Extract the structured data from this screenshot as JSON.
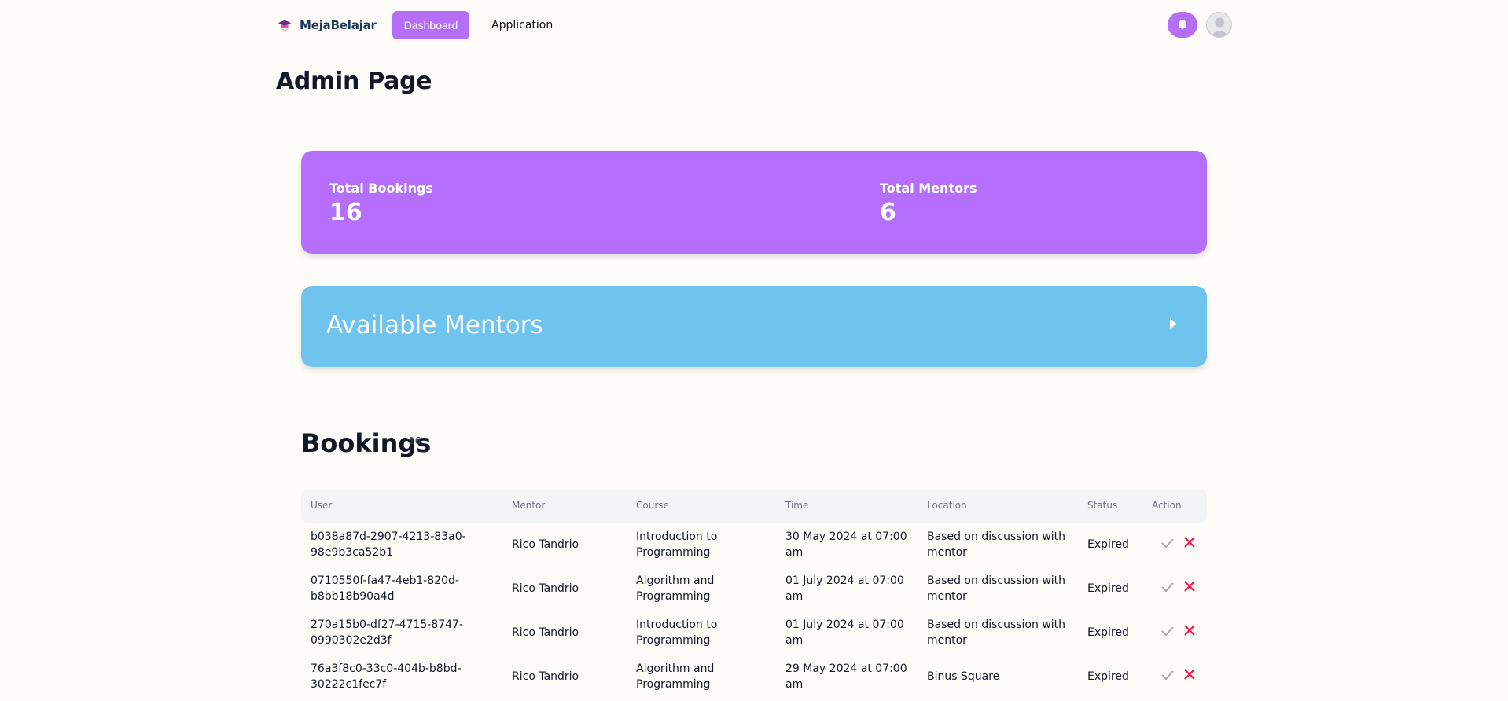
{
  "header": {
    "brand": "MejaBelajar",
    "nav": [
      {
        "label": "Dashboard",
        "active": true
      },
      {
        "label": "Application",
        "active": false
      }
    ],
    "accent_color": "#b46ef8"
  },
  "page": {
    "title": "Admin Page"
  },
  "stats": {
    "total_bookings_label": "Total Bookings",
    "total_bookings_value": "16",
    "total_mentors_label": "Total Mentors",
    "total_mentors_value": "6"
  },
  "mentors_panel": {
    "title": "Available Mentors"
  },
  "bookings": {
    "title": "Bookings",
    "count": "16",
    "columns": [
      "User",
      "Mentor",
      "Course",
      "Time",
      "Location",
      "Status",
      "Action"
    ],
    "rows": [
      {
        "user_line1": "b038a87d-2907-4213-83a0-",
        "user_line2": "98e9b3ca52b1",
        "mentor": "Rico Tandrio",
        "course_line1": "Introduction to",
        "course_line2": "Programming",
        "time_line1": "30 May 2024 at 07:00",
        "time_line2": "am",
        "location_line1": "Based on discussion with",
        "location_line2": "mentor",
        "status": "Expired"
      },
      {
        "user_line1": "0710550f-fa47-4eb1-820d-",
        "user_line2": "b8bb18b90a4d",
        "mentor": "Rico Tandrio",
        "course_line1": "Algorithm and",
        "course_line2": "Programming",
        "time_line1": "01 July 2024 at 07:00",
        "time_line2": "am",
        "location_line1": "Based on discussion with",
        "location_line2": "mentor",
        "status": "Expired"
      },
      {
        "user_line1": "270a15b0-df27-4715-8747-",
        "user_line2": "0990302e2d3f",
        "mentor": "Rico Tandrio",
        "course_line1": "Introduction to",
        "course_line2": "Programming",
        "time_line1": "01 July 2024 at 07:00",
        "time_line2": "am",
        "location_line1": "Based on discussion with",
        "location_line2": "mentor",
        "status": "Expired"
      },
      {
        "user_line1": "76a3f8c0-33c0-404b-b8bd-",
        "user_line2": "30222c1fec7f",
        "mentor": "Rico Tandrio",
        "course_line1": "Algorithm and",
        "course_line2": "Programming",
        "time_line1": "29 May 2024 at 07:00",
        "time_line2": "am",
        "location_line1": "Binus Square",
        "location_line2": "",
        "status": "Expired"
      }
    ]
  },
  "icons": {
    "logo": "graduation-cap-logo-icon",
    "bell": "bell-icon",
    "avatar": "user-avatar-icon",
    "arrow": "caret-right-icon",
    "approve": "check-icon",
    "reject": "x-icon"
  }
}
